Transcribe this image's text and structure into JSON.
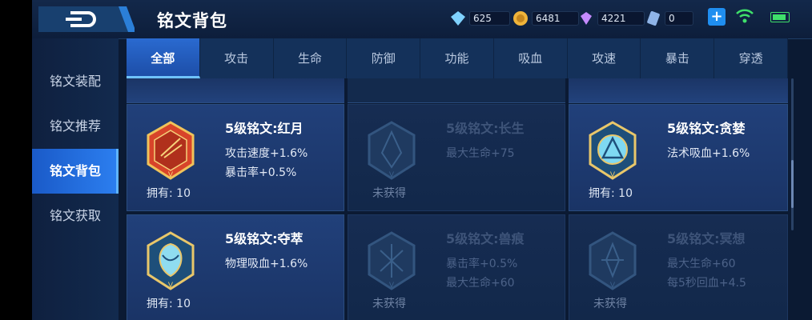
{
  "header": {
    "title": "铭文背包"
  },
  "resources": [
    {
      "icon": "crystal-icon",
      "value": "625",
      "color": "#7fd2ff"
    },
    {
      "icon": "gold-coin-icon",
      "value": "6481",
      "color": "#f0b43a"
    },
    {
      "icon": "diamond-icon",
      "value": "4221",
      "color": "#c58bff"
    },
    {
      "icon": "ticket-icon",
      "value": "0",
      "color": "#8fb4e8"
    }
  ],
  "sidebar": {
    "items": [
      {
        "label": "铭文装配"
      },
      {
        "label": "铭文推荐"
      },
      {
        "label": "铭文背包"
      },
      {
        "label": "铭文获取"
      }
    ]
  },
  "tabs": [
    "全部",
    "攻击",
    "生命",
    "防御",
    "功能",
    "吸血",
    "攻速",
    "暴击",
    "穿透"
  ],
  "cards": [
    {
      "name": "5级铭文:红月",
      "stats": [
        "攻击速度+1.6%",
        "暴击率+0.5%"
      ],
      "owned": "拥有: 10",
      "locked": false,
      "color": "#d8442a"
    },
    {
      "name": "5级铭文:长生",
      "stats": [
        "最大生命+75"
      ],
      "owned": "未获得",
      "locked": true,
      "color": "#2a4a6e"
    },
    {
      "name": "5级铭文:贪婪",
      "stats": [
        "法术吸血+1.6%"
      ],
      "owned": "拥有: 10",
      "locked": false,
      "color": "#6fd0ef"
    },
    {
      "name": "5级铭文:夺萃",
      "stats": [
        "物理吸血+1.6%"
      ],
      "owned": "拥有: 10",
      "locked": false,
      "color": "#6fd0ef"
    },
    {
      "name": "5级铭文:兽痕",
      "stats": [
        "暴击率+0.5%",
        "最大生命+60"
      ],
      "owned": "未获得",
      "locked": true,
      "color": "#2a4a6e"
    },
    {
      "name": "5级铭文:冥想",
      "stats": [
        "最大生命+60",
        "每5秒回血+4.5"
      ],
      "owned": "未获得",
      "locked": true,
      "color": "#2a4a6e"
    }
  ]
}
